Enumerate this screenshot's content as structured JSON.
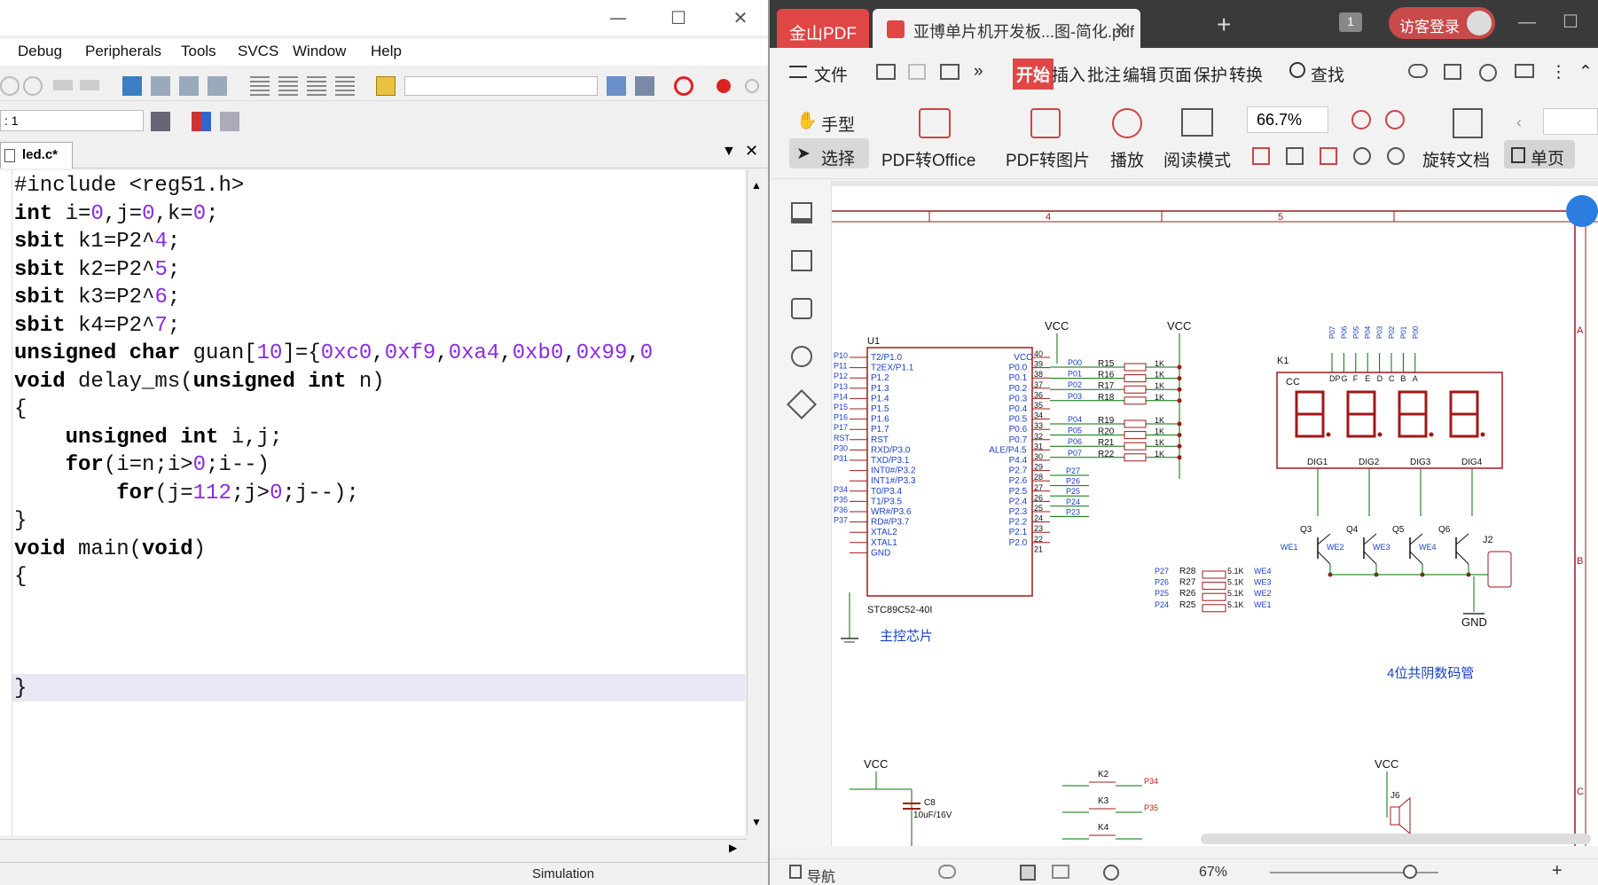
{
  "left_window": {
    "window_controls": {
      "minimize": "—",
      "maximize": "☐",
      "close": "✕"
    },
    "menu": [
      "Debug",
      "Peripherals",
      "Tools",
      "SVCS",
      "Window",
      "Help"
    ],
    "target_select_value": ": 1",
    "tab_label": "led.c*",
    "code_lines": [
      "#include <reg51.h>",
      "int i=0,j=0,k=0;",
      "sbit k1=P2^4;",
      "sbit k2=P2^5;",
      "sbit k3=P2^6;",
      "sbit k4=P2^7;",
      "unsigned char guan[10]={0xc0,0xf9,0xa4,0xb0,0x99,0",
      "void delay_ms(unsigned int n)",
      "{",
      "    unsigned int i,j;",
      "    for(i=n;i>0;i--)",
      "        for(j=112;j>0;j--);",
      "}",
      "void main(void)",
      "{",
      "",
      "",
      "",
      "}"
    ],
    "status_text": "Simulation"
  },
  "right_window": {
    "brand_tab": "金山PDF",
    "doc_tab": "亚博单片机开发板...图-简化.pdf",
    "page_count_badge": "1",
    "login_button": "访客登录",
    "menu": {
      "file": "文件",
      "start": "开始",
      "items": [
        "插入",
        "批注",
        "编辑",
        "页面",
        "保护",
        "转换"
      ],
      "search": "查找"
    },
    "toolbar": {
      "hand": "手型",
      "select": "选择",
      "pdf_to_office": "PDF转Office",
      "pdf_to_image": "PDF转图片",
      "play": "播放",
      "read_mode": "阅读模式",
      "zoom": "66.7%",
      "rotate_doc": "旋转文档",
      "single_page": "单页"
    },
    "schematic": {
      "column_labels": [
        "4",
        "5"
      ],
      "row_labels": [
        "A",
        "B",
        "C"
      ],
      "vcc": "VCC",
      "gnd": "GND",
      "chip_ref": "U1",
      "chip_name": "STC89C52-40I",
      "chip_caption": "主控芯片",
      "chip_left_pins": [
        "T2/P1.0",
        "T2EX/P1.1",
        "P1.2",
        "P1.3",
        "P1.4",
        "P1.5",
        "P1.6",
        "P1.7",
        "RST",
        "RXD/P3.0",
        "TXD/P3.1",
        "INT0#/P3.2",
        "INT1#/P3.3",
        "T0/P3.4",
        "T1/P3.5",
        "WR#/P3.6",
        "RD#/P3.7",
        "XTAL2",
        "XTAL1",
        "GND"
      ],
      "chip_right_pins": [
        "VCC",
        "P0.0",
        "P0.1",
        "P0.2",
        "P0.3",
        "P0.4",
        "P0.5",
        "P0.6",
        "P0.7",
        "ALE/P4.5",
        "P4.4",
        "P2.7",
        "P2.6",
        "P2.5",
        "P2.4",
        "P2.3",
        "P2.2",
        "P2.1",
        "P2.0"
      ],
      "right_pin_numbers": [
        "40",
        "39",
        "38",
        "37",
        "36",
        "35",
        "34",
        "33",
        "32",
        "31",
        "30",
        "29",
        "28",
        "27",
        "26",
        "25",
        "24",
        "23",
        "22",
        "21"
      ],
      "left_nets": [
        "P10",
        "P11",
        "P12",
        "P13",
        "P14",
        "P15",
        "P16",
        "P17",
        "RST",
        "P30",
        "P31",
        "",
        "",
        "P34",
        "P35",
        "P36",
        "P37"
      ],
      "p0_nets": [
        "P00",
        "P01",
        "P02",
        "P03",
        "P04",
        "P05",
        "P06",
        "P07"
      ],
      "p0_resistors": [
        "R15",
        "R16",
        "R17",
        "R18",
        "R19",
        "R20",
        "R21",
        "R22"
      ],
      "resistor_value_1k": "1K",
      "p2_nets": [
        "P27",
        "P26",
        "P25",
        "P24",
        "P23"
      ],
      "we_resistors": [
        {
          "net": "P27",
          "ref": "R28",
          "value": "5.1K",
          "we": "WE4"
        },
        {
          "net": "P26",
          "ref": "R27",
          "value": "5.1K",
          "we": "WE3"
        },
        {
          "net": "P25",
          "ref": "R26",
          "value": "5.1K",
          "we": "WE2"
        },
        {
          "net": "P24",
          "ref": "R25",
          "value": "5.1K",
          "we": "WE1"
        }
      ],
      "display_ref": "K1",
      "display_cc": "CC",
      "display_top_pins": [
        "DP",
        "G",
        "F",
        "E",
        "D",
        "C",
        "B",
        "A"
      ],
      "display_top_nets": [
        "P07",
        "P06",
        "P05",
        "P04",
        "P03",
        "P02",
        "P01",
        "P00"
      ],
      "display_digits": [
        "DIG1",
        "DIG2",
        "DIG3",
        "DIG4"
      ],
      "transistors": [
        "Q3",
        "Q4",
        "Q5",
        "Q6"
      ],
      "we_labels": [
        "WE1",
        "WE2",
        "WE3",
        "WE4"
      ],
      "connector": "J2",
      "display_caption": "4位共阴数码管",
      "cap_ref": "C8",
      "cap_value": "10uF/16V",
      "keys": [
        {
          "ref": "K2",
          "net": "P34"
        },
        {
          "ref": "K3",
          "net": "P35"
        },
        {
          "ref": "K4",
          "net": ""
        }
      ],
      "buzzer_ref": "J6"
    },
    "status": {
      "nav": "导航",
      "zoom": "67%"
    }
  }
}
